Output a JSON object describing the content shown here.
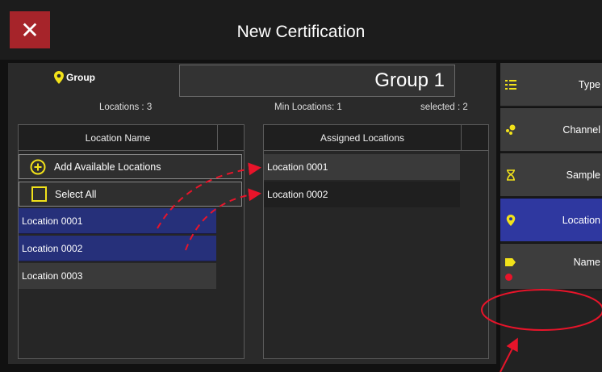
{
  "window": {
    "title": "New Certification"
  },
  "group": {
    "label": "Group",
    "value": "Group 1"
  },
  "info": {
    "locations_count": "Locations : 3",
    "min_locations": "Min Locations: 1",
    "selected": "selected : 2"
  },
  "available_panel": {
    "header": "Location Name",
    "add_button": "Add Available Locations",
    "select_all": "Select All",
    "items": [
      {
        "label": "Location 0001",
        "selected": true
      },
      {
        "label": "Location 0002",
        "selected": true
      },
      {
        "label": "Location 0003",
        "selected": false
      }
    ]
  },
  "assigned_panel": {
    "header": "Assigned Locations",
    "items": [
      {
        "label": "Location 0001"
      },
      {
        "label": "Location 0002"
      }
    ]
  },
  "sidebar": {
    "items": [
      {
        "label": "Type",
        "icon": "list-icon",
        "active": false
      },
      {
        "label": "Channel",
        "icon": "channel-dots-icon",
        "active": false
      },
      {
        "label": "Sample",
        "icon": "hourglass-icon",
        "active": false
      },
      {
        "label": "Location",
        "icon": "map-pin-icon",
        "active": true
      },
      {
        "label": "Name",
        "icon": "tag-icon",
        "active": false
      }
    ]
  },
  "colors": {
    "accent_yellow": "#f2e21a",
    "close_red": "#a6242a",
    "active_blue": "#2f38a0",
    "selected_row": "#26307a",
    "annotation_red": "#e8142a"
  }
}
